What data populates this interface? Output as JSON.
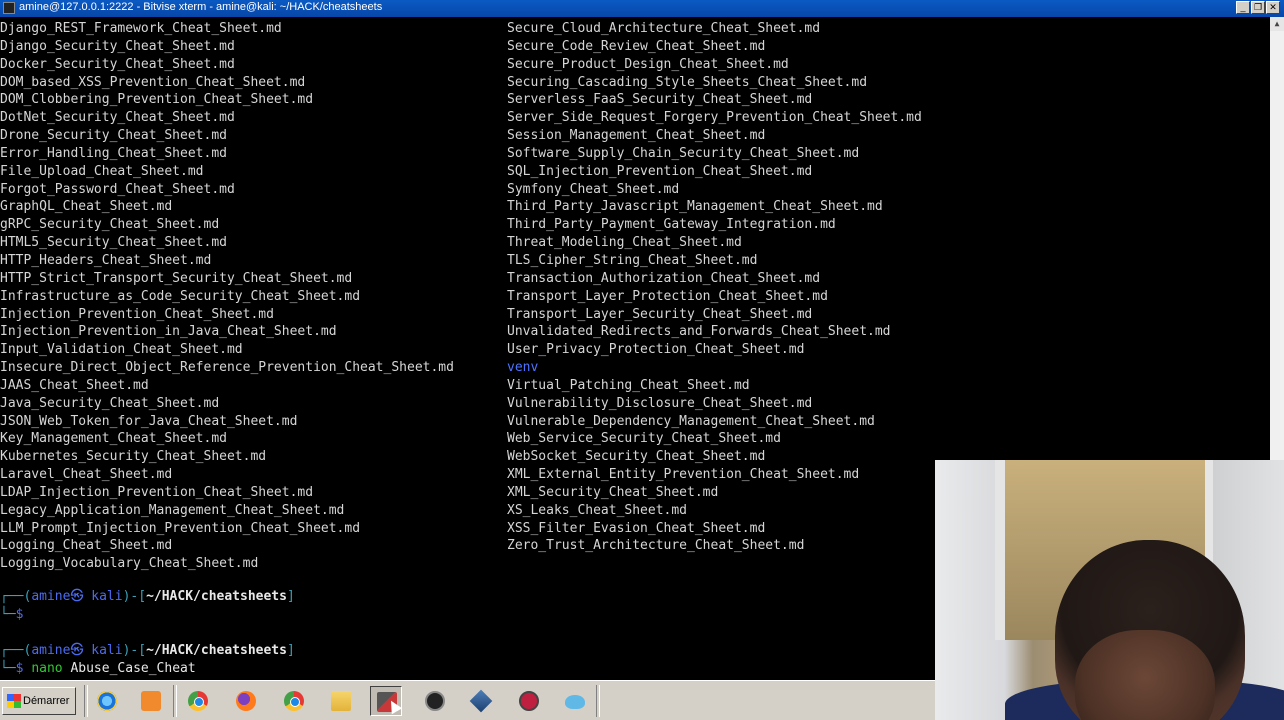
{
  "window": {
    "title": "amine@127.0.0.1:2222 - Bitvise xterm - amine@kali: ~/HACK/cheatsheets",
    "buttons": [
      "_",
      "❐",
      "✕"
    ]
  },
  "terminal": {
    "files_col1": [
      "Django_REST_Framework_Cheat_Sheet.md",
      "Django_Security_Cheat_Sheet.md",
      "Docker_Security_Cheat_Sheet.md",
      "DOM_based_XSS_Prevention_Cheat_Sheet.md",
      "DOM_Clobbering_Prevention_Cheat_Sheet.md",
      "DotNet_Security_Cheat_Sheet.md",
      "Drone_Security_Cheat_Sheet.md",
      "Error_Handling_Cheat_Sheet.md",
      "File_Upload_Cheat_Sheet.md",
      "Forgot_Password_Cheat_Sheet.md",
      "GraphQL_Cheat_Sheet.md",
      "gRPC_Security_Cheat_Sheet.md",
      "HTML5_Security_Cheat_Sheet.md",
      "HTTP_Headers_Cheat_Sheet.md",
      "HTTP_Strict_Transport_Security_Cheat_Sheet.md",
      "Infrastructure_as_Code_Security_Cheat_Sheet.md",
      "Injection_Prevention_Cheat_Sheet.md",
      "Injection_Prevention_in_Java_Cheat_Sheet.md",
      "Input_Validation_Cheat_Sheet.md",
      "Insecure_Direct_Object_Reference_Prevention_Cheat_Sheet.md",
      "JAAS_Cheat_Sheet.md",
      "Java_Security_Cheat_Sheet.md",
      "JSON_Web_Token_for_Java_Cheat_Sheet.md",
      "Key_Management_Cheat_Sheet.md",
      "Kubernetes_Security_Cheat_Sheet.md",
      "Laravel_Cheat_Sheet.md",
      "LDAP_Injection_Prevention_Cheat_Sheet.md",
      "Legacy_Application_Management_Cheat_Sheet.md",
      "LLM_Prompt_Injection_Prevention_Cheat_Sheet.md",
      "Logging_Cheat_Sheet.md",
      "Logging_Vocabulary_Cheat_Sheet.md"
    ],
    "files_col2": [
      "Secure_Cloud_Architecture_Cheat_Sheet.md",
      "Secure_Code_Review_Cheat_Sheet.md",
      "Secure_Product_Design_Cheat_Sheet.md",
      "Securing_Cascading_Style_Sheets_Cheat_Sheet.md",
      "Serverless_FaaS_Security_Cheat_Sheet.md",
      "Server_Side_Request_Forgery_Prevention_Cheat_Sheet.md",
      "Session_Management_Cheat_Sheet.md",
      "Software_Supply_Chain_Security_Cheat_Sheet.md",
      "SQL_Injection_Prevention_Cheat_Sheet.md",
      "Symfony_Cheat_Sheet.md",
      "Third_Party_Javascript_Management_Cheat_Sheet.md",
      "Third_Party_Payment_Gateway_Integration.md",
      "Threat_Modeling_Cheat_Sheet.md",
      "TLS_Cipher_String_Cheat_Sheet.md",
      "Transaction_Authorization_Cheat_Sheet.md",
      "Transport_Layer_Protection_Cheat_Sheet.md",
      "Transport_Layer_Security_Cheat_Sheet.md",
      "Unvalidated_Redirects_and_Forwards_Cheat_Sheet.md",
      "User_Privacy_Protection_Cheat_Sheet.md",
      "venv",
      "Virtual_Patching_Cheat_Sheet.md",
      "Vulnerability_Disclosure_Cheat_Sheet.md",
      "Vulnerable_Dependency_Management_Cheat_Sheet.md",
      "Web_Service_Security_Cheat_Sheet.md",
      "WebSocket_Security_Cheat_Sheet.md",
      "XML_External_Entity_Prevention_Cheat_Sheet.md",
      "XML_Security_Cheat_Sheet.md",
      "XS_Leaks_Cheat_Sheet.md",
      "XSS_Filter_Evasion_Cheat_Sheet.md",
      "Zero_Trust_Architecture_Cheat_Sheet.md"
    ],
    "directory_name": "venv",
    "prompt": {
      "open": "┌──(",
      "user": "amine㉿ kali",
      "mid": ")-[",
      "path": "~/HACK/cheatsheets",
      "close": "]",
      "line2": "└─",
      "dollar": "$"
    },
    "command": {
      "name": "nano",
      "arg": "Abuse_Case_Cheat"
    }
  },
  "taskbar": {
    "start_label": "Démarrer",
    "icons": [
      "internet-explorer-icon",
      "media-player-icon",
      "chrome-icon",
      "firefox-icon",
      "chrome-icon",
      "folder-icon",
      "terminal-app-icon",
      "obs-icon",
      "virtualbox-icon",
      "vm64-icon",
      "cloud-icon"
    ]
  },
  "colors": {
    "terminal_bg": "#000000",
    "text": "#d6d6d6",
    "directory": "#4c73ff",
    "prompt_user": "#4c6cf0",
    "command": "#2fc832",
    "titlebar": "#0a5ac4",
    "taskbar": "#d4d0c8"
  }
}
